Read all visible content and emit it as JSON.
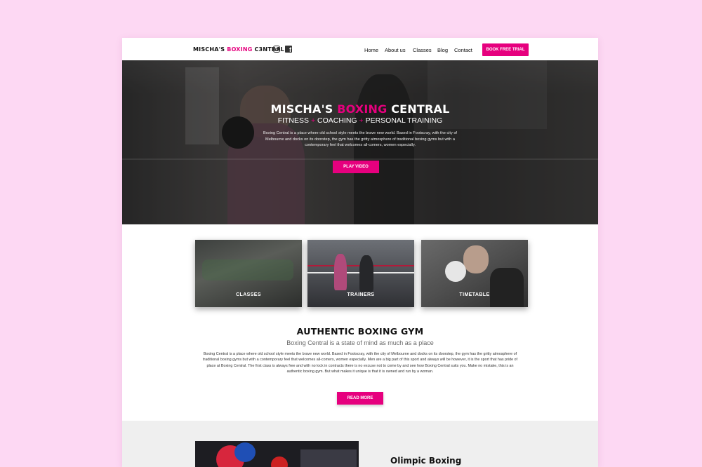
{
  "header": {
    "logo": {
      "part1": "MISCHA'S ",
      "part2": "BOXING",
      "part3": " C3NTRAL"
    },
    "social": {
      "instagram_icon": "instagram-icon",
      "facebook_icon": "facebook-icon"
    },
    "nav": [
      "Home",
      "About us",
      "Classes",
      "Blog",
      "Contact"
    ],
    "cta_label": "BOOK FREE TRIAL"
  },
  "hero": {
    "title": {
      "part1": "MISCHA'S ",
      "part2": "BOXING",
      "part3": " CENTRAL"
    },
    "subtitle": {
      "a": "FITNESS",
      "plus": "+",
      "b": "COACHING",
      "c": "PERSONAL TRAINING"
    },
    "description": "Boxing Central is a place where old school style meets the brave new world. Based in Footscray, with the city of Melbourne and docks on its doorstep, the gym has the gritty atmosphere of traditional boxing gyms but with a contemporary feel that welcomes all-comers, women especially.",
    "button_label": "PLAY VIDEO"
  },
  "tiles": [
    {
      "label": "CLASSES"
    },
    {
      "label": "TRAINERS"
    },
    {
      "label": "TIMETABLE"
    }
  ],
  "about": {
    "title": "AUTHENTIC BOXING GYM",
    "subtitle": "Boxing Central is a state of mind as much as a place",
    "body": "Boxing Central is a place where old school style meets the brave new world. Based in Footscray, with the city of Melbourne and docks on its doorstep, the gym has the gritty atmosphere of traditional boxing gyms but with a contemporary feel that welcomes all-comers, women especially. Men are a big part of this sport and always will be however, it is the sport that has pride of place at Boxing Central. The first class is always free and with no lock in contracts there is no excuse not to come by and see how Boxing Central suits you. Make no mistake, this is an authentic boxing gym. But what makes it unique is that it is owned and run by a woman.",
    "button_label": "READ MORE"
  },
  "bottom": {
    "title": "Olimpic Boxing"
  },
  "colors": {
    "accent": "#e6007e",
    "background": "#fdd8f3",
    "hero_dark": "#2d2d2d"
  }
}
